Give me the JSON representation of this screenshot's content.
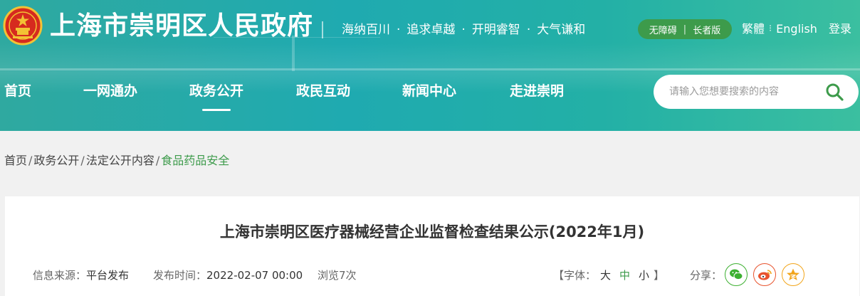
{
  "header": {
    "site_title": "上海市崇明区人民政府",
    "slogan": [
      "海纳百川",
      "追求卓越",
      "开明睿智",
      "大气谦和"
    ],
    "slogan_separator": "·",
    "accessibility": {
      "barrier_free": "无障碍",
      "separator": "|",
      "elder_mode": "长者版"
    },
    "languages": {
      "traditional": "繁體",
      "separator": "⁝",
      "english": "English"
    },
    "login": "登录"
  },
  "nav": {
    "items": [
      {
        "label": "首页"
      },
      {
        "label": "一网通办"
      },
      {
        "label": "政务公开"
      },
      {
        "label": "政民互动"
      },
      {
        "label": "新闻中心"
      },
      {
        "label": "走进崇明"
      }
    ],
    "active_index": 2
  },
  "search": {
    "placeholder": "请输入您想要搜索的内容",
    "icon": "search-icon"
  },
  "breadcrumb": {
    "items": [
      "首页",
      "政务公开",
      "法定公开内容",
      "食品药品安全"
    ],
    "separator": "/"
  },
  "article": {
    "title": "上海市崇明区医疗器械经营企业监督检查结果公示(2022年1月)",
    "source_label": "信息来源：",
    "source_value": "平台发布",
    "time_label": "发布时间：",
    "time_value": "2022-02-07 00:00",
    "views": "浏览7次",
    "font_size": {
      "open": "【字体：",
      "large": "大",
      "medium": "中",
      "small": "小",
      "close": "】",
      "active": "medium"
    },
    "share_label": "分享：",
    "share_buttons": [
      {
        "name": "wechat-icon",
        "color": "#3db031"
      },
      {
        "name": "weibo-icon",
        "color": "#e8532d"
      },
      {
        "name": "qzone-icon",
        "color": "#f2a51a"
      }
    ]
  },
  "colors": {
    "accent_green": "#3d9b4b",
    "header_teal": "#1faab0"
  }
}
